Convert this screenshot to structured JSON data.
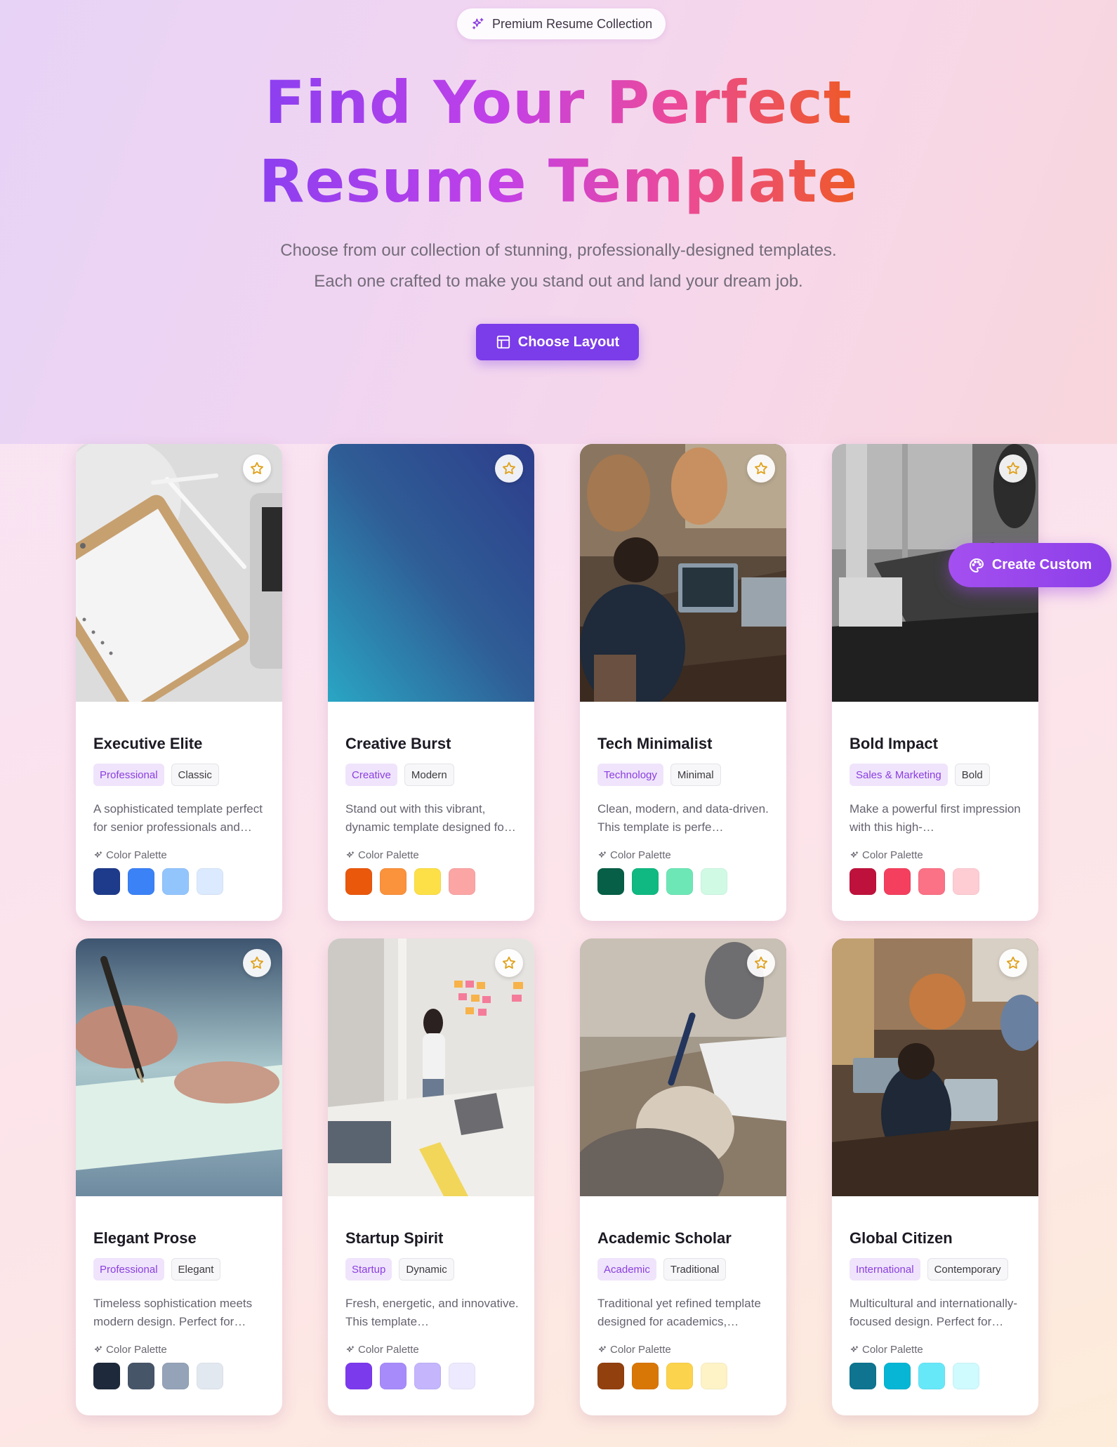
{
  "badge": {
    "icon": "sparkles-icon",
    "label": "Premium Resume Collection"
  },
  "hero": {
    "title_line1": "Find Your Perfect",
    "title_line2": "Resume Template",
    "subtitle_line1": "Choose from our collection of stunning, professionally-designed templates.",
    "subtitle_line2": "Each one crafted to make you stand out and land your dream job.",
    "cta_label": "Choose Layout",
    "cta_icon": "layout-icon"
  },
  "floating_button": {
    "label": "Create Custom",
    "icon": "palette-icon"
  },
  "palette_label": "Color Palette",
  "templates": [
    {
      "name": "Executive Elite",
      "tag1": "Professional",
      "tag2": "Classic",
      "description": "A sophisticated template perfect for senior professionals and…",
      "colors": [
        "#1e3a8a",
        "#3b82f6",
        "#93c5fd",
        "#dbeafe"
      ]
    },
    {
      "name": "Creative Burst",
      "tag1": "Creative",
      "tag2": "Modern",
      "description": "Stand out with this vibrant, dynamic template designed fo…",
      "colors": [
        "#ea580c",
        "#fb923c",
        "#fde047",
        "#fca5a5"
      ]
    },
    {
      "name": "Tech Minimalist",
      "tag1": "Technology",
      "tag2": "Minimal",
      "description": "Clean, modern, and data-driven. This template is perfe…",
      "colors": [
        "#065f46",
        "#10b981",
        "#6ee7b7",
        "#d1fae5"
      ]
    },
    {
      "name": "Bold Impact",
      "tag1": "Sales & Marketing",
      "tag2": "Bold",
      "description": "Make a powerful first impression with this high-…",
      "colors": [
        "#be123c",
        "#f43f5e",
        "#fb7185",
        "#fecdd3"
      ]
    },
    {
      "name": "Elegant Prose",
      "tag1": "Professional",
      "tag2": "Elegant",
      "description": "Timeless sophistication meets modern design. Perfect for…",
      "colors": [
        "#1e293b",
        "#475569",
        "#94a3b8",
        "#e2e8f0"
      ]
    },
    {
      "name": "Startup Spirit",
      "tag1": "Startup",
      "tag2": "Dynamic",
      "description": "Fresh, energetic, and innovative. This template…",
      "colors": [
        "#7c3aed",
        "#a78bfa",
        "#c4b5fd",
        "#ede9fe"
      ]
    },
    {
      "name": "Academic Scholar",
      "tag1": "Academic",
      "tag2": "Traditional",
      "description": "Traditional yet refined template designed for academics,…",
      "colors": [
        "#92400e",
        "#d97706",
        "#fcd34d",
        "#fef3c7"
      ]
    },
    {
      "name": "Global Citizen",
      "tag1": "International",
      "tag2": "Contemporary",
      "description": "Multicultural and internationally-focused design. Perfect for…",
      "colors": [
        "#0e7490",
        "#06b6d4",
        "#67e8f9",
        "#cffafe"
      ]
    }
  ]
}
